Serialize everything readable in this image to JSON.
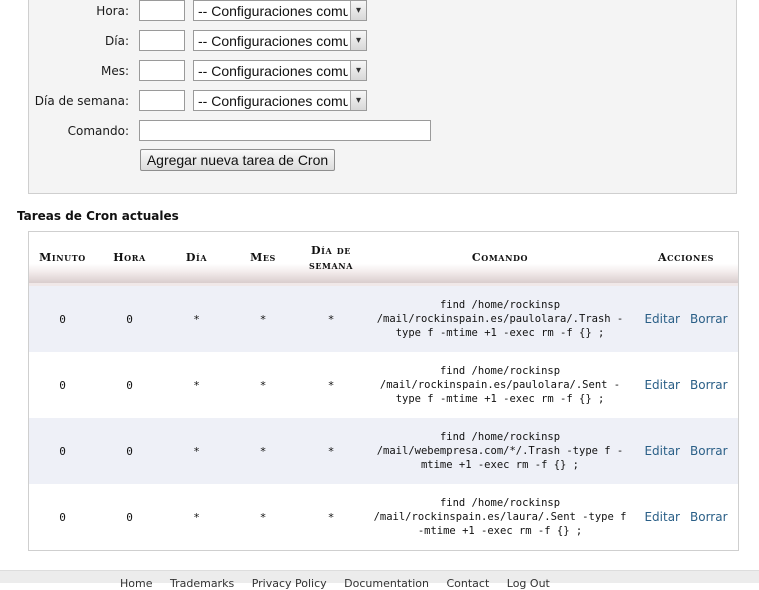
{
  "form": {
    "fields": [
      {
        "label": "Hora:",
        "value": "",
        "select_value": "-- Configuraciones comunes --"
      },
      {
        "label": "Día:",
        "value": "",
        "select_value": "-- Configuraciones comunes --"
      },
      {
        "label": "Mes:",
        "value": "",
        "select_value": "-- Configuraciones comunes --"
      },
      {
        "label": "Día de semana:",
        "value": "",
        "select_value": "-- Configuraciones comunes --"
      }
    ],
    "command_label": "Comando:",
    "command_value": "",
    "add_button_label": "Agregar nueva tarea de Cron"
  },
  "table": {
    "title": "Tareas de Cron actuales",
    "headers": [
      "Minuto",
      "Hora",
      "Día",
      "Mes",
      "Día de semana",
      "Comando",
      "Acciones"
    ],
    "rows": [
      {
        "minute": "0",
        "hour": "0",
        "day": "*",
        "month": "*",
        "weekday": "*",
        "command": "find /home/rockinsp /mail/rockinspain.es/paulolara/.Trash -type f -mtime +1 -exec rm -f {} ;",
        "edit": "Editar",
        "delete": "Borrar"
      },
      {
        "minute": "0",
        "hour": "0",
        "day": "*",
        "month": "*",
        "weekday": "*",
        "command": "find /home/rockinsp /mail/rockinspain.es/paulolara/.Sent -type f -mtime +1 -exec rm -f {} ;",
        "edit": "Editar",
        "delete": "Borrar"
      },
      {
        "minute": "0",
        "hour": "0",
        "day": "*",
        "month": "*",
        "weekday": "*",
        "command": "find /home/rockinsp /mail/webempresa.com/*/.Trash -type f -mtime +1 -exec rm -f {} ;",
        "edit": "Editar",
        "delete": "Borrar"
      },
      {
        "minute": "0",
        "hour": "0",
        "day": "*",
        "month": "*",
        "weekday": "*",
        "command": "find /home/rockinsp /mail/rockinspain.es/laura/.Sent -type f -mtime +1 -exec rm -f {} ;",
        "edit": "Editar",
        "delete": "Borrar"
      }
    ]
  },
  "footer": {
    "links": [
      "Home",
      "Trademarks",
      "Privacy Policy",
      "Documentation",
      "Contact",
      "Log Out"
    ]
  },
  "colors": {
    "link": "#2a5f87",
    "row_alt": "#eef0f7",
    "panel_bg": "#f4f4f4"
  }
}
